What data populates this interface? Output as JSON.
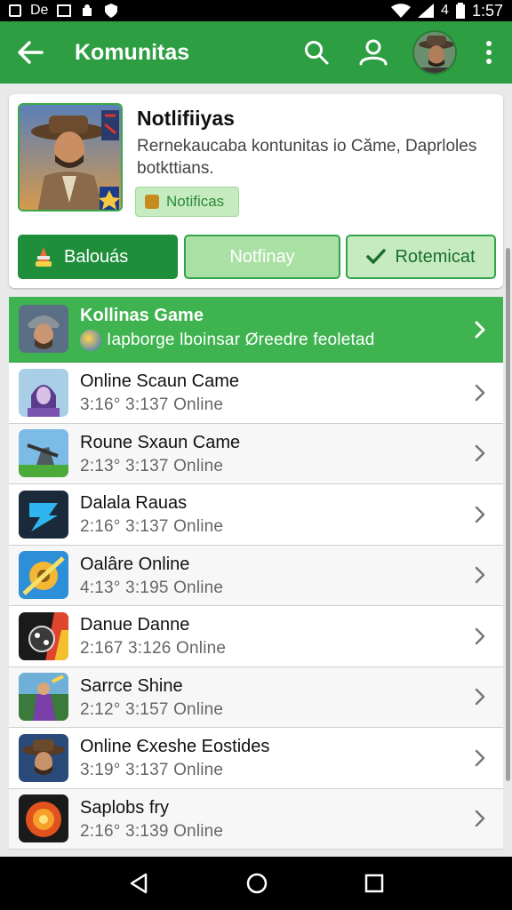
{
  "status": {
    "left_text": "De",
    "battery": "4",
    "time": "1:57"
  },
  "appbar": {
    "title": "Komunitas",
    "icons": [
      "back-arrow-icon",
      "search-icon",
      "profile-icon",
      "avatar",
      "more-vert-icon"
    ]
  },
  "card": {
    "title": "Notlifiiyas",
    "description": "Rernekaucaba kontunitas io Căme, Daprloles botkttians.",
    "badge": "Notificas",
    "buttons": [
      {
        "label": "Balouás",
        "icon": "cake-icon"
      },
      {
        "label": "Notfinay"
      },
      {
        "label": "Rotemicat",
        "icon": "check-icon"
      }
    ]
  },
  "list": [
    {
      "name": "Kollinas Game",
      "sub": "Iapborge lboinsar Øreedre feoletad",
      "active": true
    },
    {
      "name": "Online Scaun Came",
      "sub": "3:16°  3:137  Online"
    },
    {
      "name": "Roune Sxaun Came",
      "sub": "2:13°  3:137  Online"
    },
    {
      "name": "Dalala Rauas",
      "sub": "2:16°  3:137  Online"
    },
    {
      "name": "Oalâre Online",
      "sub": "4:13°  3:195  Online"
    },
    {
      "name": "Danue Danne",
      "sub": "2:167  3:126  Online"
    },
    {
      "name": "Sarrce Shine",
      "sub": "2:12°  3:157  Online"
    },
    {
      "name": "Online Єxeshe Eostides",
      "sub": "3:19°  3:137  Online"
    },
    {
      "name": "Saplobs fry",
      "sub": "2:16°  3:139  Online"
    }
  ],
  "colors": {
    "primary": "#2e9e43",
    "dark_green": "#1f8e3a",
    "light_green": "#c6ebc0"
  }
}
